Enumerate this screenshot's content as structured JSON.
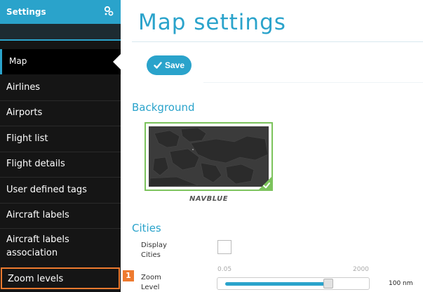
{
  "sidebar": {
    "title": "Settings",
    "settings_icon": "gear-cluster-icon",
    "items": [
      {
        "label": "Map",
        "active": true
      },
      {
        "label": "Airlines"
      },
      {
        "label": "Airports"
      },
      {
        "label": "Flight list"
      },
      {
        "label": "Flight details"
      },
      {
        "label": "User defined tags"
      },
      {
        "label": "Aircraft labels"
      },
      {
        "label": "Aircraft labels association"
      },
      {
        "label": "Zoom levels",
        "highlighted": true
      }
    ]
  },
  "callout": {
    "number": "1"
  },
  "main": {
    "title": "Map settings",
    "save_label": "Save",
    "background": {
      "heading": "Background",
      "selected_caption": "NAVBLUE"
    },
    "cities": {
      "heading": "Cities",
      "display_cities_label": "Display Cities",
      "display_cities_checked": false,
      "zoom_level_label": "Zoom Level",
      "slider_min": "0.05",
      "slider_max": "2000",
      "slider_value": "100 nm",
      "slider_fraction": 0.76
    }
  },
  "colors": {
    "accent": "#2aa3cb",
    "sidebar_bg": "#151515",
    "selected_green": "#7cc35c",
    "callout_orange": "#ee7a2f"
  }
}
